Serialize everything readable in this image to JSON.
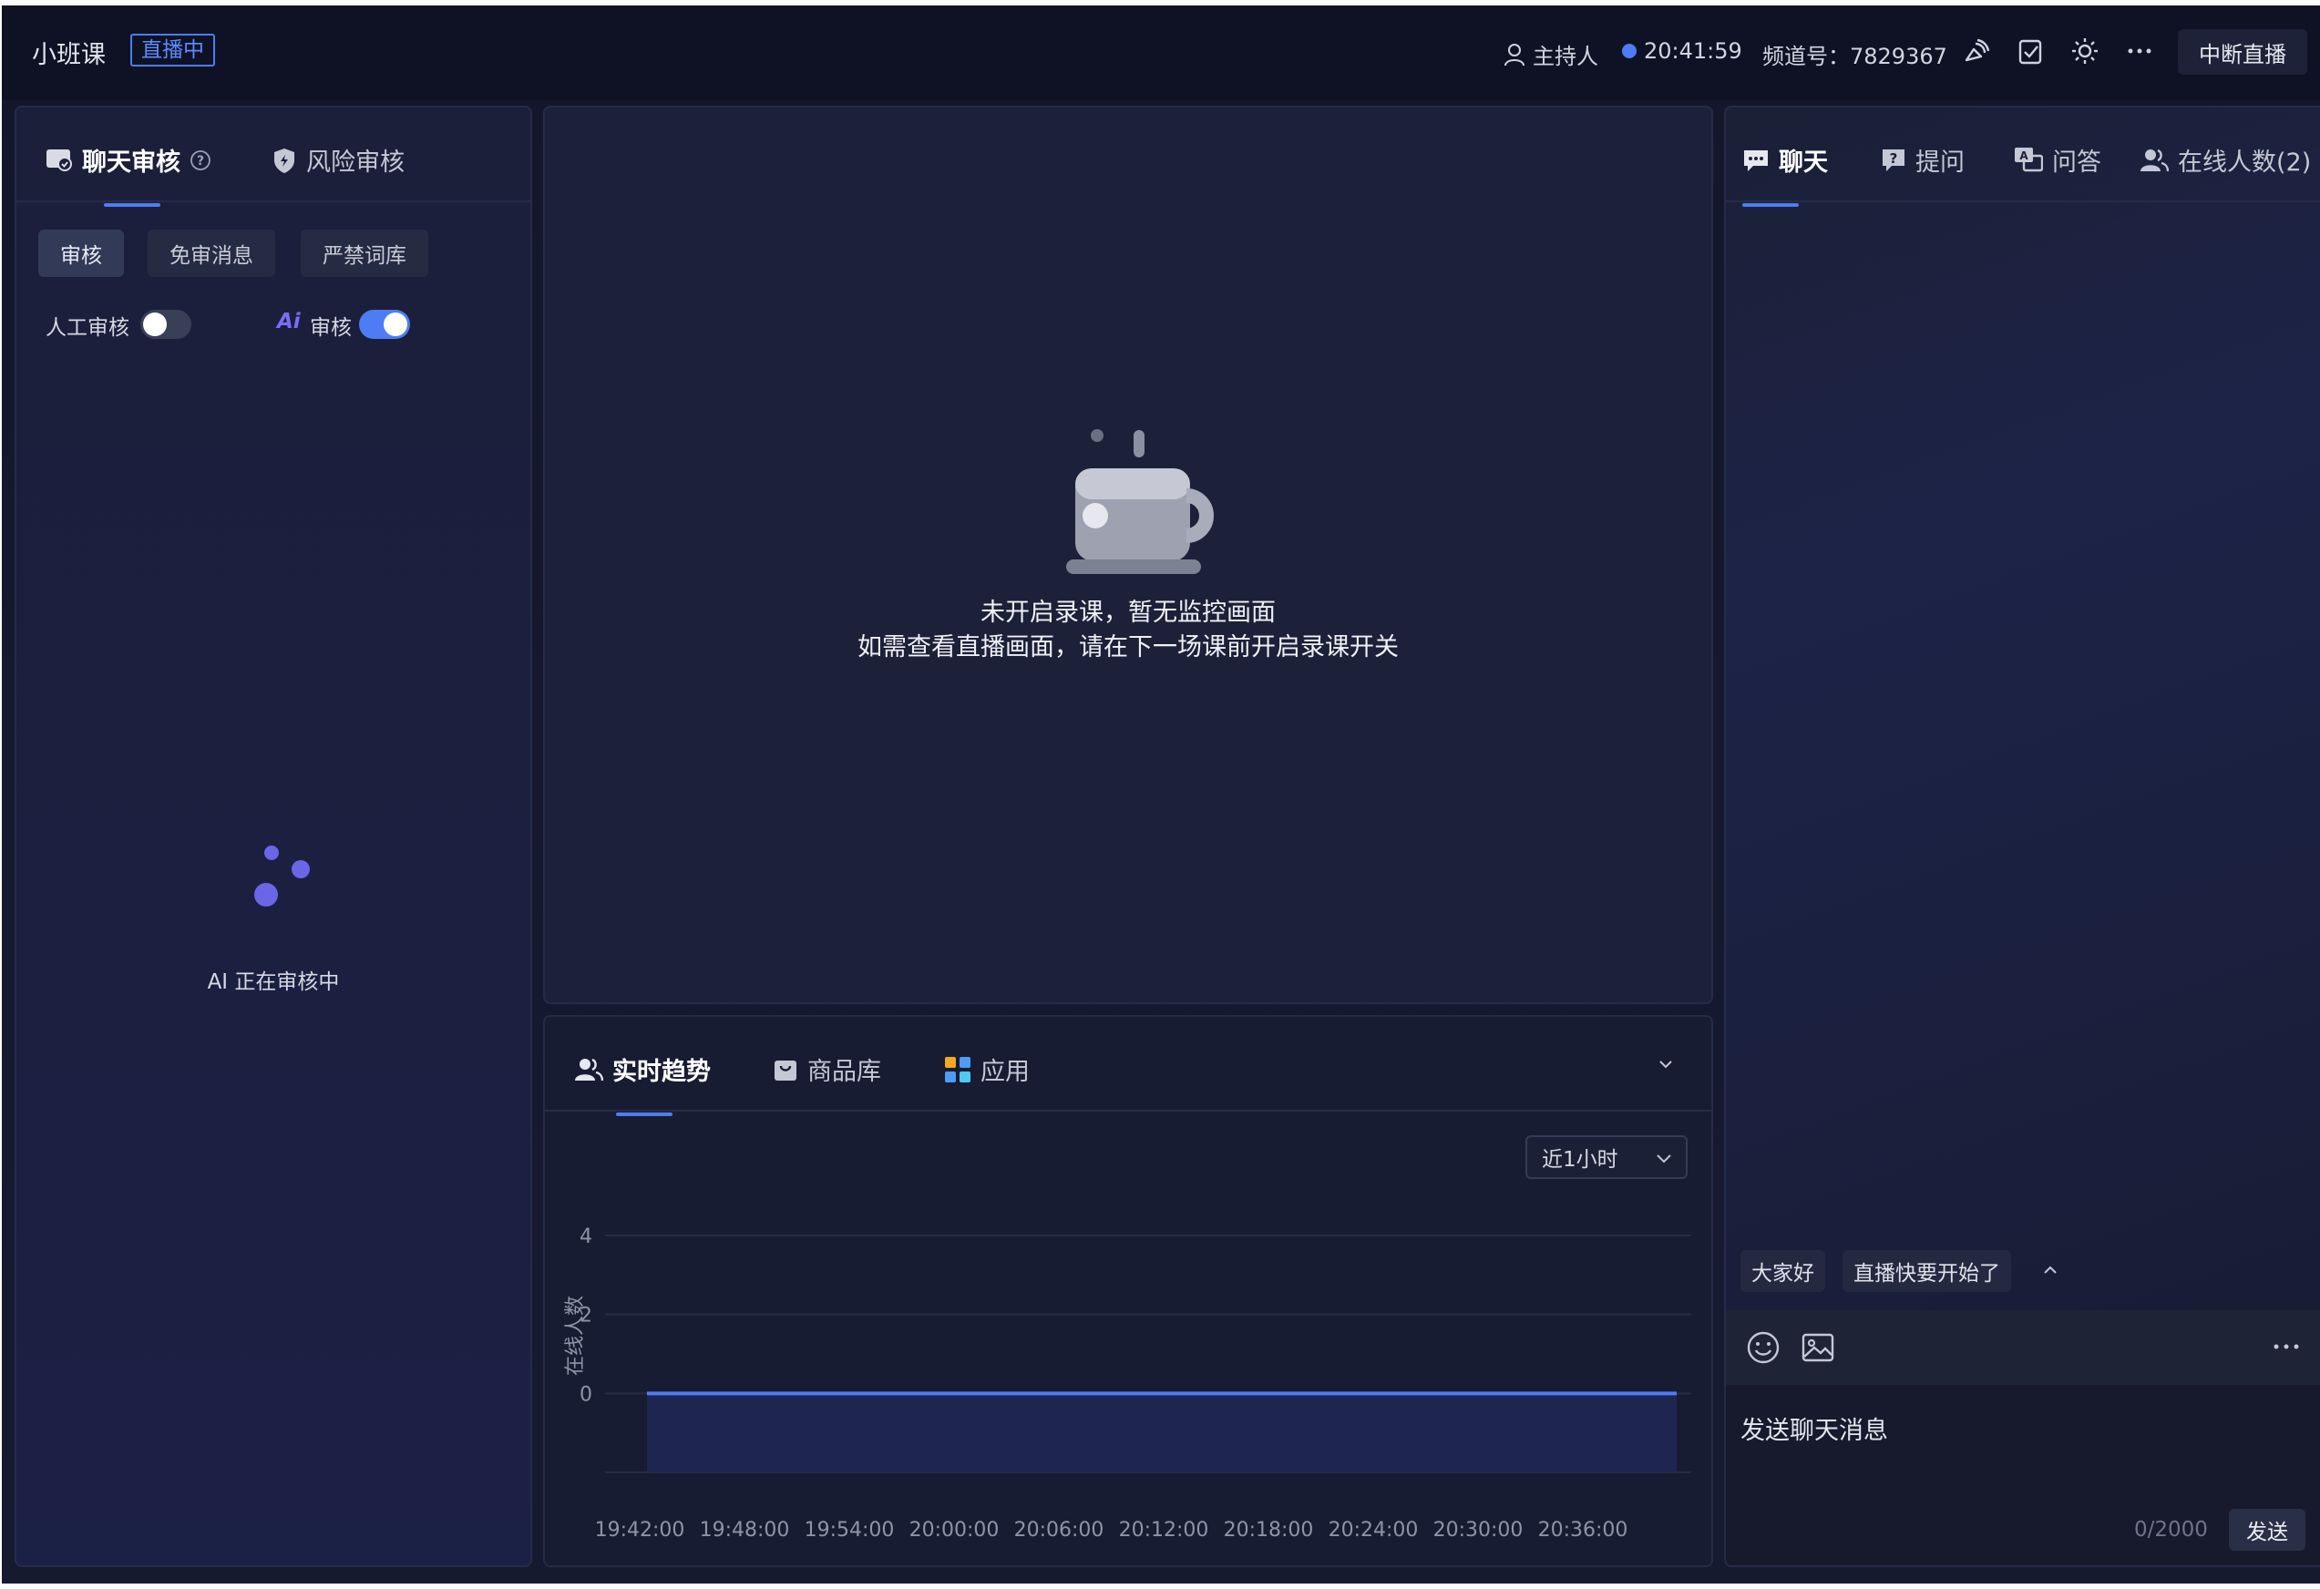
{
  "header": {
    "title": "小班课",
    "live_badge": "直播中",
    "role": "主持人",
    "time": "20:41:59",
    "channel": "频道号：7829367",
    "stop_label": "中断直播"
  },
  "review": {
    "tabs": [
      "聊天审核",
      "风险审核"
    ],
    "chips": [
      "审核",
      "免审消息",
      "严禁词库"
    ],
    "manual_label": "人工审核",
    "manual_on": false,
    "ai_mark": "Ai",
    "ai_label": "审核",
    "ai_on": true,
    "status": "AI 正在审核中"
  },
  "monitor": {
    "line1": "未开启录课，暂无监控画面",
    "line2": "如需查看直播画面，请在下一场课前开启录课开关"
  },
  "trend": {
    "tabs": [
      "实时趋势",
      "商品库",
      "应用"
    ],
    "range": "近1小时"
  },
  "chart_data": {
    "type": "area",
    "ylabel": "在线人数",
    "xlabel": "",
    "x": [
      "19:42:00",
      "19:48:00",
      "19:54:00",
      "20:00:00",
      "20:06:00",
      "20:12:00",
      "20:18:00",
      "20:24:00",
      "20:30:00",
      "20:36:00"
    ],
    "values": [
      0,
      0,
      0,
      0,
      0,
      0,
      0,
      0,
      0,
      0
    ],
    "yticks": [
      4,
      2,
      0
    ],
    "ylim": [
      -2,
      4
    ],
    "grid": true,
    "line_color": "#4e7cf4"
  },
  "chat": {
    "tabs": [
      "聊天",
      "提问",
      "问答",
      "在线人数(2)"
    ],
    "quick_replies": [
      "大家好",
      "直播快要开始了"
    ],
    "placeholder": "发送聊天消息",
    "counter": "0/2000",
    "send_label": "发送"
  },
  "colors": {
    "accent": "#4e7cf4",
    "ai": "#7b6cf6"
  }
}
